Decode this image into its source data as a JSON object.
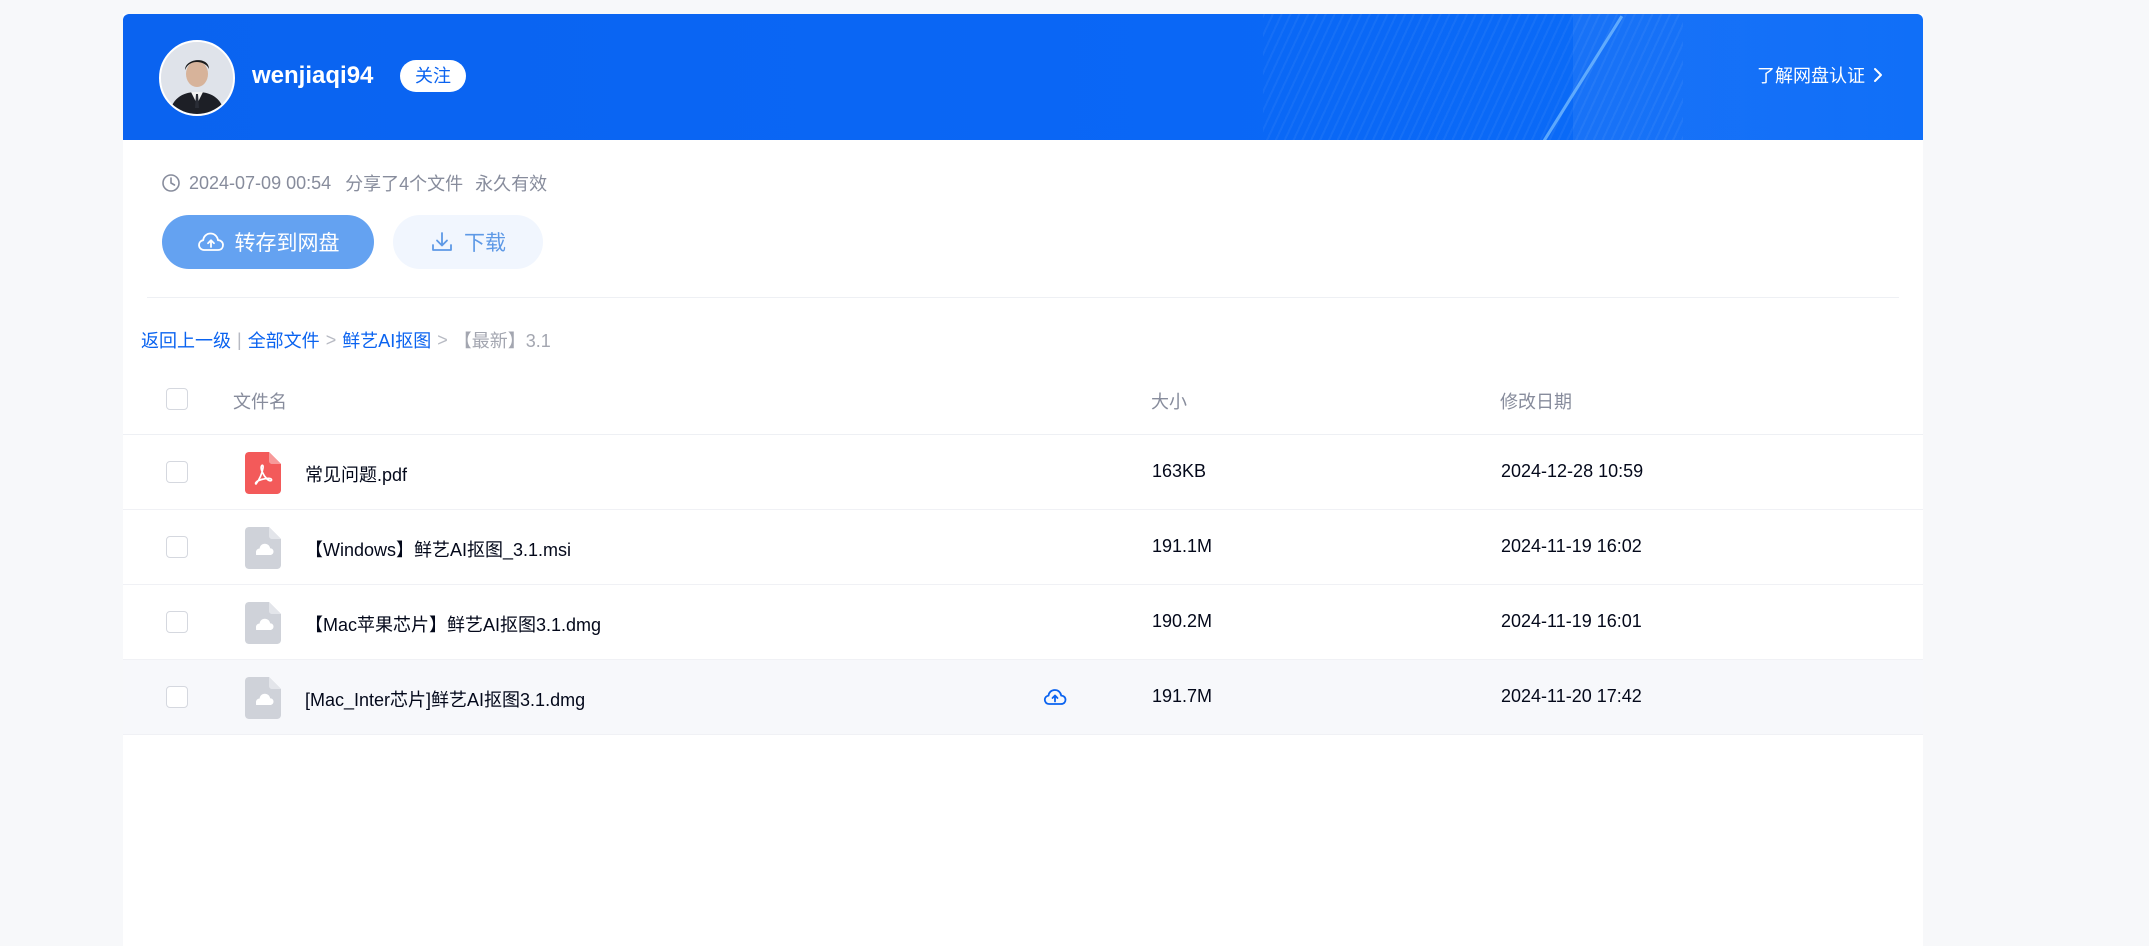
{
  "header": {
    "username": "wenjiaqi94",
    "follow_label": "关注",
    "learn_link": "了解网盘认证"
  },
  "share_info": {
    "timestamp": "2024-07-09 00:54",
    "file_count": "分享了4个文件",
    "validity": "永久有效"
  },
  "actions": {
    "save_label": "转存到网盘",
    "download_label": "下载"
  },
  "breadcrumb": {
    "back": "返回上一级",
    "sep1": "|",
    "all_files": "全部文件",
    "arrow1": ">",
    "folder": "鲜艺AI抠图",
    "arrow2": ">",
    "current": "【最新】3.1"
  },
  "table": {
    "headers": {
      "name": "文件名",
      "size": "大小",
      "date": "修改日期"
    },
    "rows": [
      {
        "name": "常见问题.pdf",
        "size": "163KB",
        "date": "2024-12-28 10:59",
        "icon": "pdf-icon"
      },
      {
        "name": "【Windows】鲜艺AI抠图_3.1.msi",
        "size": "191.1M",
        "date": "2024-11-19 16:02",
        "icon": "cloud-file-icon"
      },
      {
        "name": "【Mac苹果芯片】鲜艺AI抠图3.1.dmg",
        "size": "190.2M",
        "date": "2024-11-19 16:01",
        "icon": "cloud-file-icon"
      },
      {
        "name": "[Mac_Inter芯片]鲜艺AI抠图3.1.dmg",
        "size": "191.7M",
        "date": "2024-11-20 17:42",
        "icon": "cloud-file-icon"
      }
    ]
  },
  "colors": {
    "banner_blue": "#0a63f0",
    "primary_button": "#64a2f1",
    "link_blue": "#0a63f0",
    "pdf_red": "#f35a5a",
    "file_gray": "#cfd2d9"
  }
}
